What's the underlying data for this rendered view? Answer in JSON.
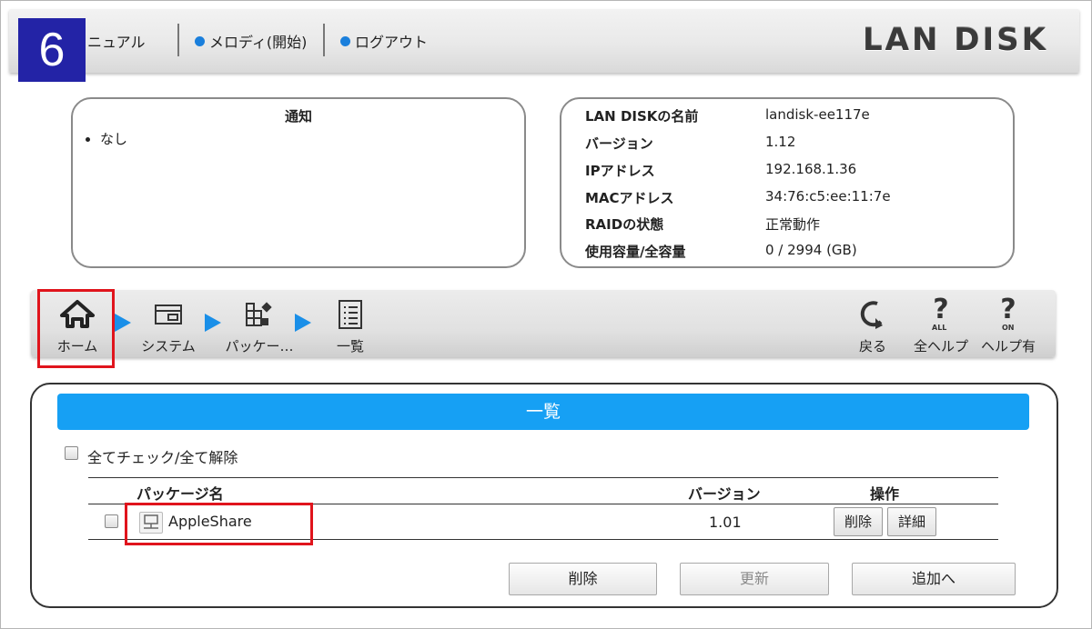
{
  "step_badge": "6",
  "header": {
    "links": [
      {
        "label": "ニュアル",
        "icon": "bullet-dot-icon"
      },
      {
        "label": "メロディ(開始)",
        "icon": "bullet-dot-icon"
      },
      {
        "label": "ログアウト",
        "icon": "bullet-dot-icon"
      }
    ],
    "logo": "LAN DISK",
    "accent_color": "#1a7fdc"
  },
  "notice": {
    "title": "通知",
    "items": [
      "なし"
    ]
  },
  "device_info": {
    "rows": [
      {
        "key": "LAN DISKの名前",
        "value": "landisk-ee117e"
      },
      {
        "key": "バージョン",
        "value": "1.12"
      },
      {
        "key": "IPアドレス",
        "value": "192.168.1.36"
      },
      {
        "key": "MACアドレス",
        "value": "34:76:c5:ee:11:7e"
      },
      {
        "key": "RAIDの状態",
        "value": "正常動作"
      },
      {
        "key": "使用容量/全容量",
        "value": "0 / 2994 (GB)"
      }
    ]
  },
  "toolbar": {
    "breadcrumb": [
      {
        "label": "ホーム",
        "icon": "home-icon"
      },
      {
        "label": "システム",
        "icon": "system-window-icon"
      },
      {
        "label": "パッケー…",
        "icon": "package-icon"
      },
      {
        "label": "一覧",
        "icon": "list-icon"
      }
    ],
    "right": [
      {
        "label": "戻る",
        "icon": "back-icon"
      },
      {
        "label": "全ヘルプ",
        "icon": "help-all-icon",
        "badge": "ALL"
      },
      {
        "label": "ヘルプ有",
        "icon": "help-on-icon",
        "badge": "ON"
      }
    ]
  },
  "panel": {
    "title": "一覧",
    "check_all_label": "全てチェック/全て解除",
    "columns": [
      "パッケージ名",
      "バージョン",
      "操作"
    ],
    "rows": [
      {
        "name": "AppleShare",
        "version": "1.01",
        "actions": [
          "削除",
          "詳細"
        ]
      }
    ],
    "buttons": {
      "delete": "削除",
      "update": "更新",
      "add": "追加へ"
    },
    "header_color": "#16a0f4"
  },
  "highlight_color": "#e0141c"
}
